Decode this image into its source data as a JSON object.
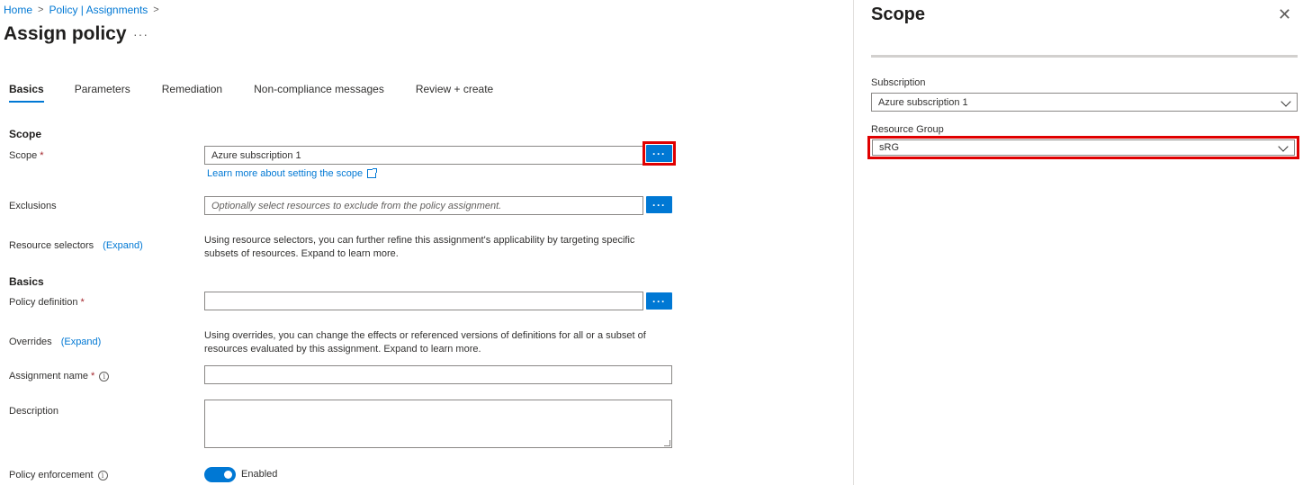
{
  "breadcrumb": {
    "home": "Home",
    "policy": "Policy | Assignments",
    "sep": ">"
  },
  "page": {
    "title": "Assign policy",
    "more": "···"
  },
  "tabs": [
    {
      "label": "Basics",
      "active": true
    },
    {
      "label": "Parameters",
      "active": false
    },
    {
      "label": "Remediation",
      "active": false
    },
    {
      "label": "Non-compliance messages",
      "active": false
    },
    {
      "label": "Review + create",
      "active": false
    }
  ],
  "form": {
    "scope_section": "Scope",
    "scope_label": "Scope",
    "scope_value": "Azure subscription 1",
    "scope_link": "Learn more about setting the scope",
    "exclusions_label": "Exclusions",
    "exclusions_placeholder": "Optionally select resources to exclude from the policy assignment.",
    "resource_selectors_label": "Resource selectors",
    "resource_selectors_expand": "(Expand)",
    "resource_selectors_desc": "Using resource selectors, you can further refine this assignment's applicability by targeting specific subsets of resources. Expand to learn more.",
    "basics_section": "Basics",
    "policy_definition_label": "Policy definition",
    "policy_definition_value": "",
    "overrides_label": "Overrides",
    "overrides_expand": "(Expand)",
    "overrides_desc": "Using overrides, you can change the effects or referenced versions of definitions for all or a subset of resources evaluated by this assignment. Expand to learn more.",
    "assignment_name_label": "Assignment name",
    "assignment_name_value": "",
    "description_label": "Description",
    "description_value": "",
    "enforcement_label": "Policy enforcement",
    "enforcement_value": "Enabled",
    "required_mark": "*",
    "ellipsis": "···"
  },
  "pane": {
    "title": "Scope",
    "close": "✕",
    "subscription_label": "Subscription",
    "subscription_value": "Azure subscription 1",
    "resource_group_label": "Resource Group",
    "resource_group_value": "sRG"
  },
  "colors": {
    "accent": "#0078d4",
    "highlight": "#e00000",
    "required": "#a4262c"
  },
  "icons": [
    "chevron-right-icon",
    "more-icon",
    "info-icon",
    "external-link-icon",
    "close-icon",
    "chevron-down-icon"
  ]
}
